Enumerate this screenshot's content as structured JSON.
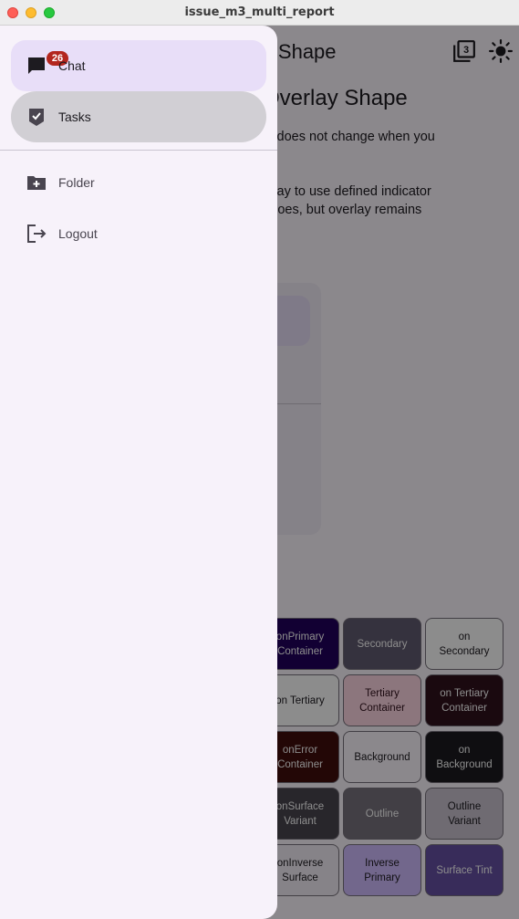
{
  "window": {
    "title": "issue_m3_multi_report"
  },
  "appbar": {
    "title": "icator Shape",
    "icons": [
      "filter-3-icon",
      "brightness-icon"
    ]
  },
  "content": {
    "heading": "or Overlay Shape",
    "para1_line1": "shape does not change when you",
    "para2_line1": "e overlay to use defined indicator",
    "para2_line2": "cator does, but overlay remains"
  },
  "chips": [
    {
      "label": "onPrimary Container",
      "bg": "#21005d",
      "fg": "#ffffff"
    },
    {
      "label": "Secondary",
      "bg": "#625b71",
      "fg": "#ffffff"
    },
    {
      "label": "on Secondary",
      "bg": "#ffffff",
      "fg": "#1d1b20"
    },
    {
      "label": "on Tertiary",
      "bg": "#ffffff",
      "fg": "#1d1b20"
    },
    {
      "label": "Tertiary Container",
      "bg": "#ffd8e4",
      "fg": "#31111d"
    },
    {
      "label": "on Tertiary Container",
      "bg": "#31111d",
      "fg": "#ffffff"
    },
    {
      "label": "onError Container",
      "bg": "#410e0b",
      "fg": "#ffffff"
    },
    {
      "label": "Background",
      "bg": "#fef7ff",
      "fg": "#1d1b20"
    },
    {
      "label": "on Background",
      "bg": "#1d1b20",
      "fg": "#ffffff"
    },
    {
      "label": "onSurface Variant",
      "bg": "#49454f",
      "fg": "#ffffff"
    },
    {
      "label": "Outline",
      "bg": "#79747e",
      "fg": "#ffffff"
    },
    {
      "label": "Outline Variant",
      "bg": "#cac4d0",
      "fg": "#1d1b20"
    },
    {
      "label": "onInverse Surface",
      "bg": "#f5eff7",
      "fg": "#1d1b20"
    },
    {
      "label": "Inverse Primary",
      "bg": "#d0bcff",
      "fg": "#1d1b20"
    },
    {
      "label": "Surface Tint",
      "bg": "#6750a4",
      "fg": "#ffffff"
    }
  ],
  "drawer": {
    "items": [
      {
        "label": "Chat",
        "icon": "chat-icon",
        "badge": "26"
      },
      {
        "label": "Tasks",
        "icon": "tasks-icon"
      },
      {
        "label": "Folder",
        "icon": "create-folder-icon"
      },
      {
        "label": "Logout",
        "icon": "logout-icon"
      }
    ]
  }
}
